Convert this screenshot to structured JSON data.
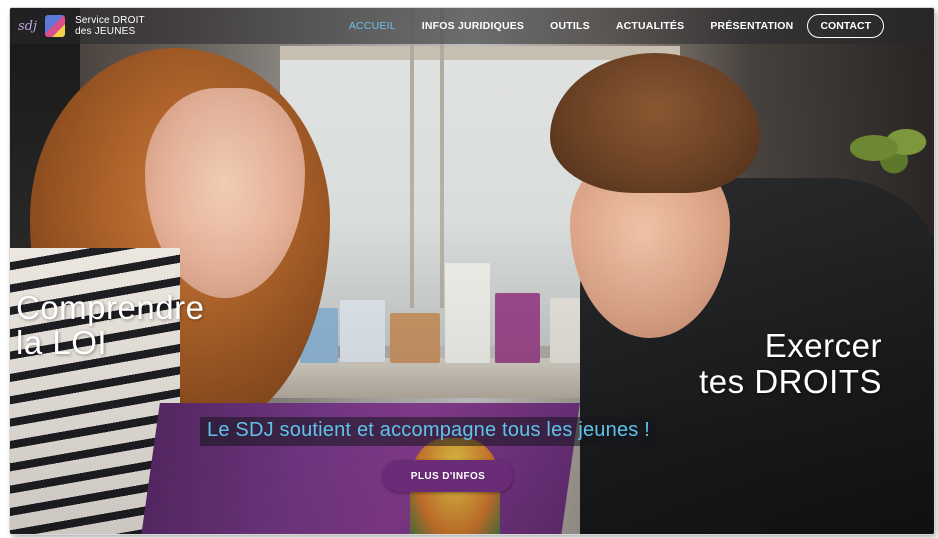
{
  "header": {
    "brand_mark": "sdj",
    "brand_line1": "Service DROIT",
    "brand_line2": "des JEUNES"
  },
  "nav": {
    "items": [
      "ACCUEIL",
      "INFOS JURIDIQUES",
      "OUTILS",
      "ACTUALITÉS",
      "PRÉSENTATION"
    ],
    "active": "ACCUEIL",
    "contact": "CONTACT"
  },
  "hero": {
    "left_line1": "Comprendre",
    "left_line2": "la LOI",
    "right_line1": "Exercer",
    "right_line2": "tes DROITS",
    "tagline": "Le SDJ soutient et accompagne tous les jeunes !",
    "cta": "PLUS D'INFOS"
  },
  "colors": {
    "nav_active": "#6ec0e8",
    "tagline": "#5fc3ea",
    "cta_bg": "#6a2b77"
  }
}
